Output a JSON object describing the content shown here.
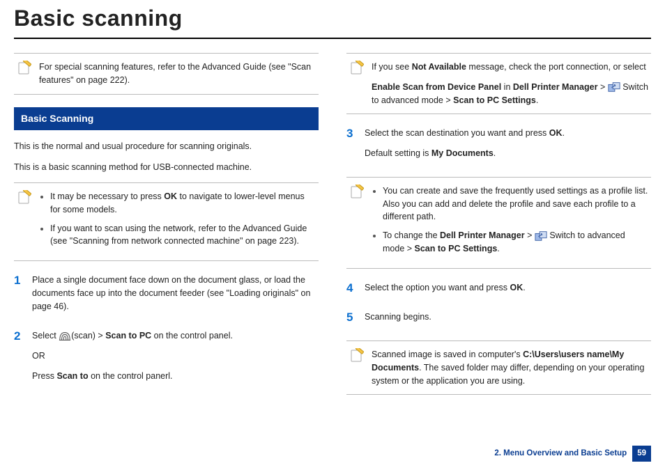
{
  "title": "Basic scanning",
  "left": {
    "note1": "For special scanning features, refer to the Advanced Guide (see \"Scan features\" on page 222).",
    "section_header": "Basic Scanning",
    "intro1": "This is the normal and usual procedure for scanning originals.",
    "intro2": "This is a basic scanning method for USB-connected machine.",
    "note2_item1_pre": "It may be necessary to press ",
    "note2_item1_bold": "OK",
    "note2_item1_post": " to navigate to lower-level menus for some models.",
    "note2_item2": "If you want to scan using the network, refer to the Advanced Guide (see \"Scanning from network connected machine\" on page 223).",
    "step1_num": "1",
    "step1_text": "Place a single document face down on the document glass, or load the documents face up into the document feeder (see \"Loading originals\" on page 46).",
    "step2_num": "2",
    "step2_pre": "Select ",
    "step2_mid1": "(scan) > ",
    "step2_bold1": "Scan to PC",
    "step2_post1": " on the control panel.",
    "step2_or": "OR",
    "step2_press": "Press ",
    "step2_bold2": "Scan to",
    "step2_post2": " on the control panerl."
  },
  "right": {
    "note1_a": "If you see ",
    "note1_b": "Not Available",
    "note1_c": " message, check the port connection, or select ",
    "note1_d": "Enable Scan from Device Panel",
    "note1_e": " in ",
    "note1_f": "Dell Printer Manager",
    "note1_g": " > ",
    "note1_h": " Switch to advanced mode > ",
    "note1_i": "Scan to PC Settings",
    "note1_j": ".",
    "step3_num": "3",
    "step3_a": "Select the scan destination you want and press ",
    "step3_b": "OK",
    "step3_c": ".",
    "step3_d": "Default setting is ",
    "step3_e": "My Documents",
    "step3_f": ".",
    "note2_item1": "You can create and save the frequently used settings as a profile list. Also you can add and delete the profile and save each profile to a different path.",
    "note2_item2_a": "To change the ",
    "note2_item2_b": "Dell Printer Manager",
    "note2_item2_c": " > ",
    "note2_item2_d": " Switch to advanced mode > ",
    "note2_item2_e": "Scan to PC Settings",
    "note2_item2_f": ".",
    "step4_num": "4",
    "step4_a": "Select the option you want and press ",
    "step4_b": "OK",
    "step4_c": ".",
    "step5_num": "5",
    "step5_a": "Scanning begins.",
    "note3_a": "Scanned image is saved in computer's ",
    "note3_b": "C:\\Users\\users name\\My Documents",
    "note3_c": ". The saved folder may differ, depending on your operating system or the application you are using."
  },
  "footer": {
    "chapter": "2. Menu Overview and Basic Setup",
    "page": "59"
  }
}
